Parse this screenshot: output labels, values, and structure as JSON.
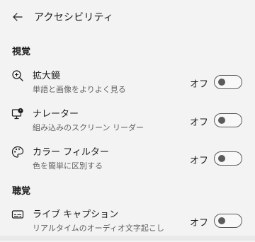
{
  "header": {
    "back_icon": "back-arrow-icon",
    "title": "アクセシビリティ"
  },
  "sections": [
    {
      "title": "視覚",
      "items": [
        {
          "icon": "magnifier-icon",
          "title": "拡大鏡",
          "description": "単語と画像をよりよく見る",
          "state": "オフ",
          "enabled": false
        },
        {
          "icon": "narrator-icon",
          "title": "ナレーター",
          "description": "組み込みのスクリーン リーダー",
          "state": "オフ",
          "enabled": false
        },
        {
          "icon": "palette-icon",
          "title": "カラー フィルター",
          "description": "色を簡単に区別する",
          "state": "オフ",
          "enabled": false
        }
      ]
    },
    {
      "title": "聴覚",
      "items": [
        {
          "icon": "captions-icon",
          "title": "ライブ キャプション",
          "description": "リアルタイムのオーディオ文字起こし",
          "state": "オフ",
          "enabled": false
        }
      ]
    }
  ]
}
